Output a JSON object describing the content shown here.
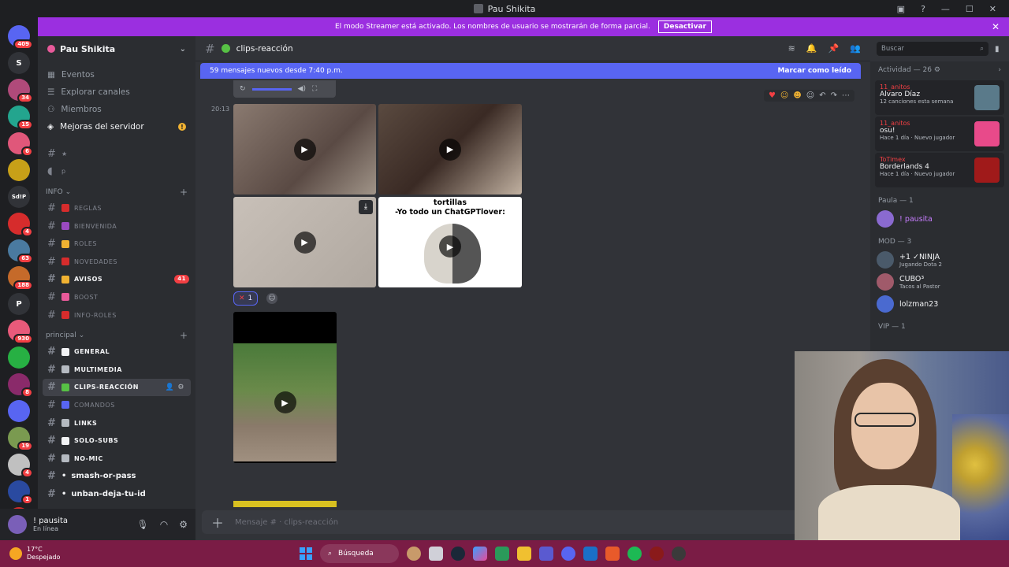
{
  "window": {
    "title": "Pau Shikita"
  },
  "streamer_bar": {
    "message": "El modo Streamer está activado. Los nombres de usuario se mostrarán de forma parcial.",
    "button": "Desactivar"
  },
  "guilds": [
    {
      "label": "",
      "badge": "409",
      "color": "#5865f2"
    },
    {
      "label": "S",
      "badge": "",
      "color": "#313338"
    },
    {
      "label": "",
      "badge": "34",
      "color": "#b04a7a"
    },
    {
      "label": "",
      "badge": "15",
      "color": "#23a58e"
    },
    {
      "label": "",
      "badge": "6",
      "color": "#e0577a"
    },
    {
      "label": "",
      "badge": "",
      "color": "#c8a018"
    },
    {
      "label": "Sd!P",
      "badge": "",
      "color": "#313338"
    },
    {
      "label": "",
      "badge": "4",
      "color": "#d62c2c"
    },
    {
      "label": "",
      "badge": "63",
      "color": "#4a7aa0"
    },
    {
      "label": "",
      "badge": "188",
      "color": "#c56a2a"
    },
    {
      "label": "P",
      "badge": "",
      "color": "#313338"
    },
    {
      "label": "",
      "badge": "930",
      "color": "#e85a7a"
    },
    {
      "label": "",
      "badge": "",
      "color": "#27b043"
    },
    {
      "label": "",
      "badge": "8",
      "color": "#8a2a6a"
    },
    {
      "label": "",
      "badge": "",
      "color": "#5865f2"
    },
    {
      "label": "",
      "badge": "19",
      "color": "#7a9a50"
    },
    {
      "label": "",
      "badge": "4",
      "color": "#c0c0c0"
    },
    {
      "label": "",
      "badge": "1",
      "color": "#2a4aa0"
    },
    {
      "label": "NUEVO",
      "badge": "114",
      "color": "#d62c2c"
    }
  ],
  "server": {
    "name": "Pau Shikita"
  },
  "sidebar_top": [
    "Eventos",
    "Explorar canales",
    "Miembros",
    "Mejoras del servidor"
  ],
  "pre_channels": [
    {
      "name": "★"
    },
    {
      "name": "p"
    }
  ],
  "categories": {
    "info": "INFO",
    "principal": "principal"
  },
  "info_channels": [
    {
      "name": "REGLAS",
      "color": "#d62c2c",
      "unread": false,
      "badge": ""
    },
    {
      "name": "BIENVENIDA",
      "color": "#9a4ac0",
      "unread": false,
      "badge": ""
    },
    {
      "name": "ROLES",
      "color": "#f0b232",
      "unread": false,
      "badge": ""
    },
    {
      "name": "NOVEDADES",
      "color": "#d62c2c",
      "unread": false,
      "badge": ""
    },
    {
      "name": "AVISOS",
      "color": "#f0b232",
      "unread": true,
      "badge": "41"
    },
    {
      "name": "BOOST",
      "color": "#e85a9a",
      "unread": false,
      "badge": ""
    },
    {
      "name": "INFO-ROLES",
      "color": "#d62c2c",
      "unread": false,
      "badge": ""
    }
  ],
  "principal_channels": [
    {
      "name": "GENERAL",
      "color": "#f2f3f5",
      "unread": true,
      "active": false
    },
    {
      "name": "MULTIMEDIA",
      "color": "#b5bac1",
      "unread": true,
      "active": false
    },
    {
      "name": "clips-reacción",
      "color": "#57c145",
      "unread": true,
      "active": true
    },
    {
      "name": "COMANDOS",
      "color": "#5865f2",
      "unread": false,
      "active": false
    },
    {
      "name": "LINKS",
      "color": "#b5bac1",
      "unread": true,
      "active": false
    },
    {
      "name": "SOLO-SUBS",
      "color": "#f2f3f5",
      "unread": true,
      "active": false
    },
    {
      "name": "NO-MIC",
      "color": "#b5bac1",
      "unread": true,
      "active": false
    },
    {
      "name": "smash-or-pass",
      "color": "",
      "unread": true,
      "active": false,
      "plain": true
    },
    {
      "name": "unban-deja-tu-id",
      "color": "",
      "unread": true,
      "active": false,
      "plain": true
    }
  ],
  "user": {
    "name": "! pausita",
    "status": "En línea"
  },
  "channel": {
    "name": "clips-reacción"
  },
  "search": {
    "placeholder": "Buscar"
  },
  "new_messages": {
    "text": "59 mensajes nuevos desde 7:40 p.m.",
    "mark": "Marcar como leído"
  },
  "message": {
    "time": "20:13",
    "reaction_count": "1"
  },
  "video_caption": {
    "line1": "tortillas",
    "line2": "-Yo todo un ChatGPTlover:"
  },
  "composer": {
    "placeholder": "Mensaje #  ·  clips-reacción"
  },
  "activity": {
    "header": "Actividad — 26",
    "cards": [
      {
        "user": "11_anitos",
        "game": "Alvaro Díaz",
        "sub": "12 canciones esta semana",
        "color": "#5a7a8a"
      },
      {
        "user": "11_anitos",
        "game": "osu!",
        "sub": "Hace 1 día · Nuevo jugador",
        "color": "#e84a8a"
      },
      {
        "user": "ToTimex",
        "game": "Borderlands 4",
        "sub": "Hace 1 día · Nuevo jugador",
        "color": "#a01a1a"
      }
    ]
  },
  "member_groups": [
    {
      "title": "Paula — 1",
      "members": [
        {
          "name": "! pausita",
          "sub": "",
          "color": "#8a6ad0",
          "name_color": "#c77dff"
        }
      ]
    },
    {
      "title": "MOD — 3",
      "members": [
        {
          "name": "+1 ✓NINJA",
          "sub": "Jugando Dota 2",
          "color": "#4a5a6a",
          "name_color": "#f2f3f5"
        },
        {
          "name": "CUBO³",
          "sub": "Tacos al Pastor",
          "color": "#a05a6a",
          "name_color": "#f2f3f5"
        },
        {
          "name": "lolzman23",
          "sub": "",
          "color": "#4a6ad0",
          "name_color": "#f2f3f5"
        }
      ]
    },
    {
      "title": "VIP — 1",
      "members": []
    }
  ],
  "taskbar": {
    "temp": "17°C",
    "weather": "Despejado",
    "search": "Búsqueda"
  }
}
